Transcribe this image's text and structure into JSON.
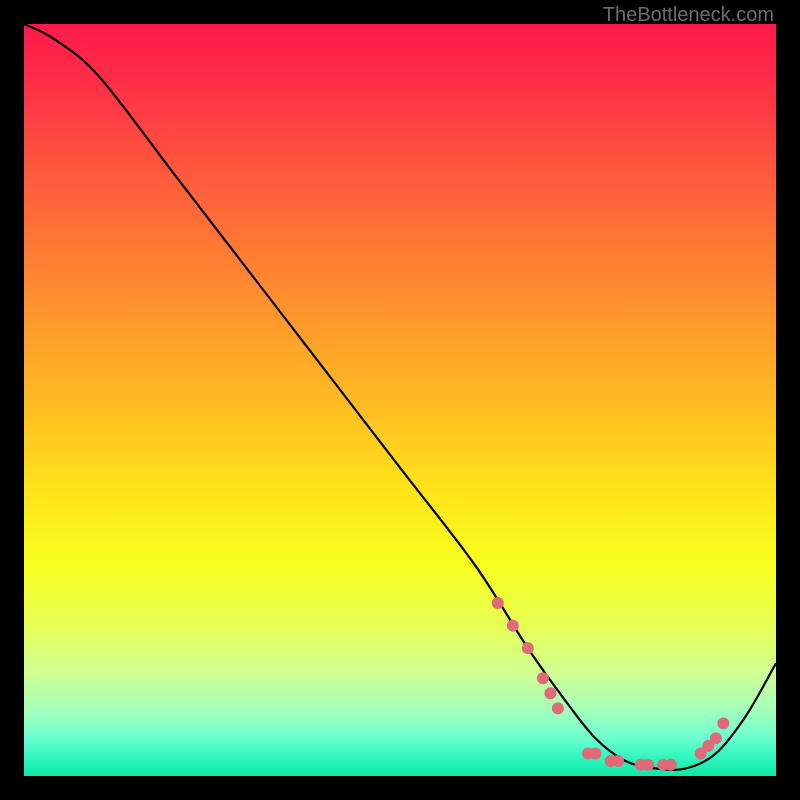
{
  "attribution": "TheBottleneck.com",
  "chart_data": {
    "type": "line",
    "title": "",
    "xlabel": "",
    "ylabel": "",
    "xlim": [
      0,
      100
    ],
    "ylim": [
      0,
      100
    ],
    "background_gradient": {
      "stops": [
        {
          "offset": 0.0,
          "color": "#ff1a4b"
        },
        {
          "offset": 0.08,
          "color": "#ff2f47"
        },
        {
          "offset": 0.2,
          "color": "#ff5a3d"
        },
        {
          "offset": 0.35,
          "color": "#ff8a30"
        },
        {
          "offset": 0.5,
          "color": "#ffba23"
        },
        {
          "offset": 0.62,
          "color": "#ffe41a"
        },
        {
          "offset": 0.72,
          "color": "#f8ff1f"
        },
        {
          "offset": 0.8,
          "color": "#e7ff56"
        },
        {
          "offset": 0.86,
          "color": "#d0ff8f"
        },
        {
          "offset": 0.91,
          "color": "#a6ffb8"
        },
        {
          "offset": 0.95,
          "color": "#6dffd0"
        },
        {
          "offset": 0.975,
          "color": "#30f7bf"
        },
        {
          "offset": 1.0,
          "color": "#0ee8a6"
        }
      ]
    },
    "series": [
      {
        "name": "bottleneck-curve",
        "color": "#000000",
        "x": [
          0,
          4,
          10,
          20,
          30,
          40,
          50,
          60,
          67,
          72,
          76,
          80,
          84,
          88,
          92,
          96,
          100
        ],
        "y": [
          100,
          98,
          93,
          80,
          67,
          54,
          41,
          28,
          17,
          10,
          5,
          2,
          1,
          1,
          3,
          8,
          15
        ]
      }
    ],
    "markers": {
      "name": "sweet-spot-dots",
      "color": "#e06a78",
      "radius": 6,
      "points": [
        {
          "x": 63,
          "y": 23
        },
        {
          "x": 65,
          "y": 20
        },
        {
          "x": 67,
          "y": 17
        },
        {
          "x": 69,
          "y": 13
        },
        {
          "x": 70,
          "y": 11
        },
        {
          "x": 71,
          "y": 9
        },
        {
          "x": 75,
          "y": 3
        },
        {
          "x": 76,
          "y": 3
        },
        {
          "x": 78,
          "y": 2
        },
        {
          "x": 79,
          "y": 2
        },
        {
          "x": 82,
          "y": 1.5
        },
        {
          "x": 83,
          "y": 1.5
        },
        {
          "x": 85,
          "y": 1.5
        },
        {
          "x": 86,
          "y": 1.5
        },
        {
          "x": 90,
          "y": 3
        },
        {
          "x": 91,
          "y": 4
        },
        {
          "x": 92,
          "y": 5
        },
        {
          "x": 93,
          "y": 7
        }
      ]
    }
  }
}
